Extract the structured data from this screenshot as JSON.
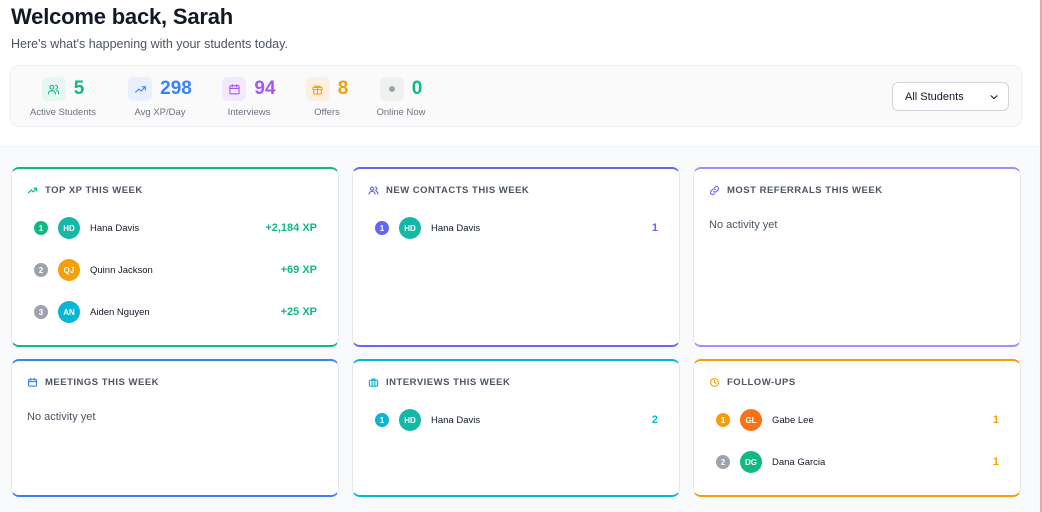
{
  "header": {
    "title": "Welcome back, Sarah",
    "subtitle": "Here's what's happening with your students today."
  },
  "stats": [
    {
      "value": "5",
      "label": "Active Students",
      "icon": "users-icon",
      "color": "#10b981",
      "bg": "#e6f7f0"
    },
    {
      "value": "298",
      "label": "Avg XP/Day",
      "icon": "trending-up-icon",
      "color": "#3b82f6",
      "bg": "#e8f0fe"
    },
    {
      "value": "94",
      "label": "Interviews",
      "icon": "calendar-icon",
      "color": "#a855f7",
      "bg": "#f3e8fd"
    },
    {
      "value": "8",
      "label": "Offers",
      "icon": "gift-icon",
      "color": "#f59e0b",
      "bg": "#fdf0e2"
    },
    {
      "value": "0",
      "label": "Online Now",
      "icon": "dot-icon",
      "color": "#10b981",
      "bg": "#eef1ee"
    }
  ],
  "filter": {
    "selected": "All Students"
  },
  "cards": {
    "top_xp": {
      "title": "TOP XP THIS WEEK",
      "icon": "trending-up-icon",
      "accent": "#10b981",
      "rows": [
        {
          "rank": "1",
          "initials": "HD",
          "name": "Hana Davis",
          "value": "+2,184 XP",
          "rank_color": "#10b981",
          "avatar_color": "#14b8a6"
        },
        {
          "rank": "2",
          "initials": "QJ",
          "name": "Quinn Jackson",
          "value": "+69 XP",
          "rank_color": "#9ca3af",
          "avatar_color": "#f59e0b"
        },
        {
          "rank": "3",
          "initials": "AN",
          "name": "Aiden Nguyen",
          "value": "+25 XP",
          "rank_color": "#9ca3af",
          "avatar_color": "#06b6d4"
        }
      ]
    },
    "new_contacts": {
      "title": "NEW CONTACTS THIS WEEK",
      "icon": "users-icon",
      "accent": "#6366f1",
      "rows": [
        {
          "rank": "1",
          "initials": "HD",
          "name": "Hana Davis",
          "value": "1",
          "rank_color": "#6366f1",
          "avatar_color": "#14b8a6"
        }
      ]
    },
    "most_referrals": {
      "title": "MOST REFERRALS THIS WEEK",
      "icon": "link-icon",
      "accent": "#a78bfa",
      "empty": "No activity yet"
    },
    "meetings": {
      "title": "MEETINGS THIS WEEK",
      "icon": "calendar-icon",
      "accent": "#3b82f6",
      "empty": "No activity yet"
    },
    "interviews": {
      "title": "INTERVIEWS THIS WEEK",
      "icon": "briefcase-icon",
      "accent": "#06b6d4",
      "rows": [
        {
          "rank": "1",
          "initials": "HD",
          "name": "Hana Davis",
          "value": "2",
          "rank_color": "#06b6d4",
          "avatar_color": "#14b8a6"
        }
      ]
    },
    "follow_ups": {
      "title": "FOLLOW-UPS",
      "icon": "clock-icon",
      "accent": "#f59e0b",
      "rows": [
        {
          "rank": "1",
          "initials": "GL",
          "name": "Gabe Lee",
          "value": "1",
          "rank_color": "#f59e0b",
          "avatar_color": "#f97316"
        },
        {
          "rank": "2",
          "initials": "DG",
          "name": "Dana Garcia",
          "value": "1",
          "rank_color": "#9ca3af",
          "avatar_color": "#10b981"
        }
      ]
    }
  }
}
